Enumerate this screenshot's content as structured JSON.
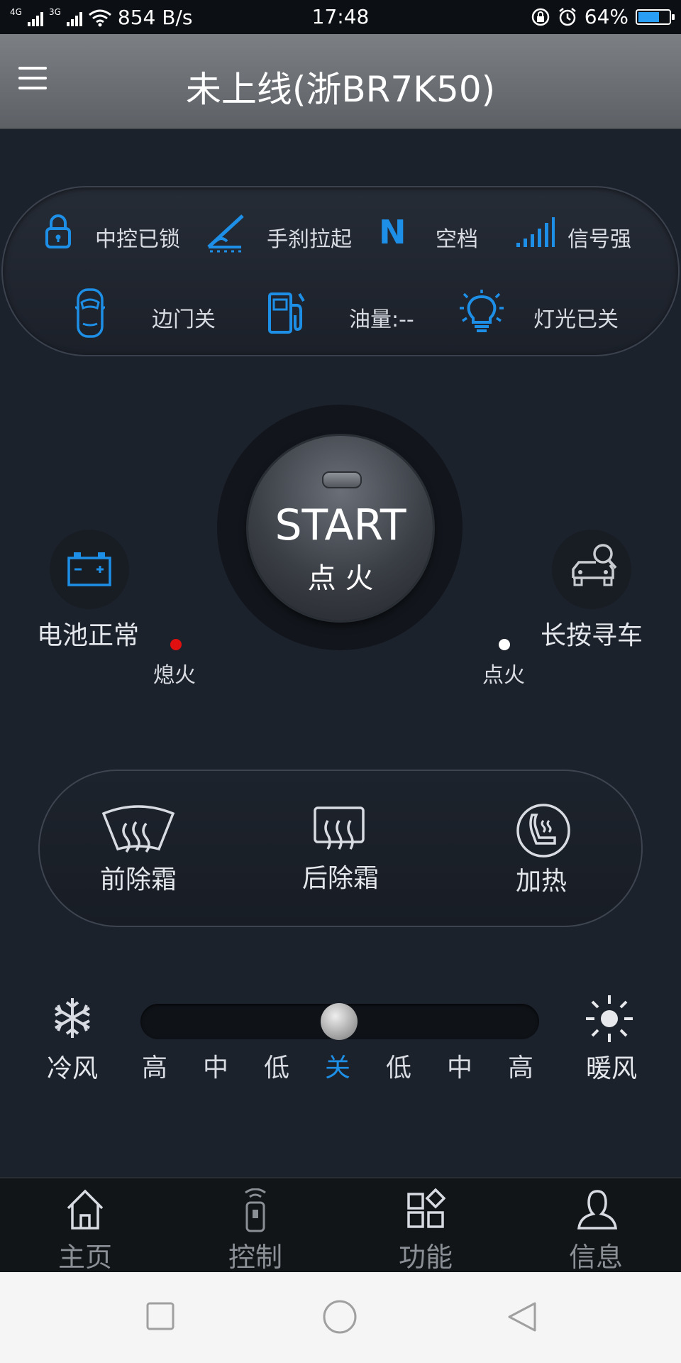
{
  "status_bar": {
    "net1": "4G",
    "net2": "3G",
    "speed": "854 B/s",
    "time": "17:48",
    "battery": "64%",
    "battery_level": 0.64
  },
  "header": {
    "title": "未上线(浙BR7K50)",
    "menu_icon": "hamburger-menu-icon"
  },
  "vehicle_status": {
    "lock": "中控已锁",
    "handbrake": "手刹拉起",
    "gear_symbol": "N",
    "gear": "空档",
    "signal": "信号强",
    "door": "边门关",
    "fuel": "油量:--",
    "lights": "灯光已关"
  },
  "engine": {
    "start_label": "START",
    "start_sub": "点 火",
    "off_label": "熄火",
    "on_label": "点火"
  },
  "battery_widget": {
    "label": "电池正常"
  },
  "find_car": {
    "label": "长按寻车"
  },
  "climate": {
    "front_defrost": "前除霜",
    "rear_defrost": "后除霜",
    "heating": "加热"
  },
  "fan": {
    "cold": "冷风",
    "warm": "暖风",
    "levels": [
      "高",
      "中",
      "低",
      "关",
      "低",
      "中",
      "高"
    ],
    "selected": 3
  },
  "tabs": [
    {
      "label": "主页",
      "icon": "home-icon"
    },
    {
      "label": "控制",
      "icon": "remote-icon"
    },
    {
      "label": "功能",
      "icon": "grid-icon"
    },
    {
      "label": "信息",
      "icon": "user-icon"
    }
  ],
  "colors": {
    "accent": "#1e8fe6",
    "off_dot": "#e01010",
    "on_dot": "#ffffff"
  }
}
